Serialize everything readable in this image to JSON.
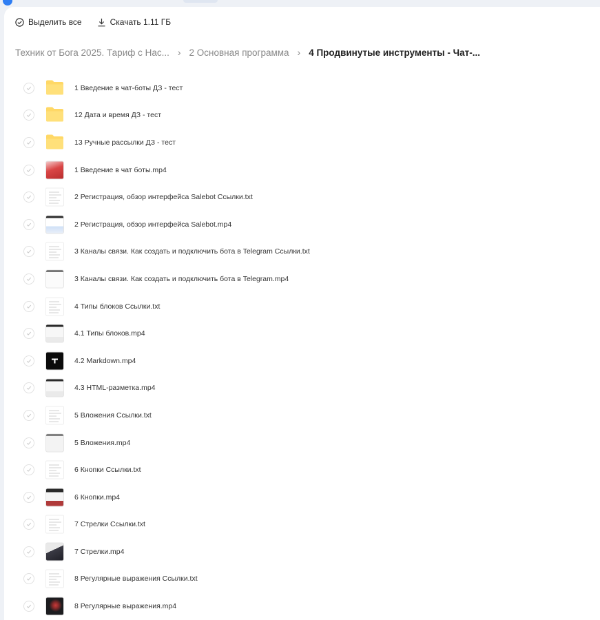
{
  "toolbar": {
    "select_all_label": "Выделить все",
    "download_label": "Скачать 1.11 ГБ"
  },
  "breadcrumb": [
    "Техник от Бога 2025. Тариф с Нас...",
    "2 Основная программа",
    "4 Продвинутые инструменты - Чат-..."
  ],
  "files": [
    {
      "name": "1 Введение в чат-боты ДЗ - тест",
      "kind": "folder"
    },
    {
      "name": "12 Дата и время ДЗ - тест",
      "kind": "folder"
    },
    {
      "name": "13 Ручные рассылки ДЗ - тест",
      "kind": "folder"
    },
    {
      "name": "1 Введение в чат боты.mp4",
      "kind": "video",
      "thumb": "red"
    },
    {
      "name": "2 Регистрация, обзор интерфейса Salebot Ссылки.txt",
      "kind": "doc"
    },
    {
      "name": "2 Регистрация, обзор интерфейса Salebot.mp4",
      "kind": "video",
      "thumb": "ui-blue"
    },
    {
      "name": "3 Каналы связи. Как создать и подключить бота в Telegram Ссылки.txt",
      "kind": "doc"
    },
    {
      "name": "3 Каналы связи. Как создать и подключить бота в Telegram.mp4",
      "kind": "video",
      "thumb": "light"
    },
    {
      "name": "4 Типы блоков Ссылки.txt",
      "kind": "doc"
    },
    {
      "name": "4.1 Типы блоков.mp4",
      "kind": "video",
      "thumb": "light-dark"
    },
    {
      "name": "4.2 Markdown.mp4",
      "kind": "video",
      "thumb": "black"
    },
    {
      "name": "4.3 HTML-разметка.mp4",
      "kind": "video",
      "thumb": "light-dark"
    },
    {
      "name": "5 Вложения Ссылки.txt",
      "kind": "doc"
    },
    {
      "name": "5 Вложения.mp4",
      "kind": "video",
      "thumb": "light-gray"
    },
    {
      "name": "6 Кнопки Ссылки.txt",
      "kind": "doc"
    },
    {
      "name": "6 Кнопки.mp4",
      "kind": "video",
      "thumb": "dark-red"
    },
    {
      "name": "7 Стрелки Ссылки.txt",
      "kind": "doc"
    },
    {
      "name": "7 Стрелки.mp4",
      "kind": "video",
      "thumb": "dark-mount"
    },
    {
      "name": "8 Регулярные выражения Ссылки.txt",
      "kind": "doc"
    },
    {
      "name": "8 Регулярные выражения.mp4",
      "kind": "video",
      "thumb": "dark-face"
    }
  ],
  "colors": {
    "background": "#eef1f6",
    "panel": "#ffffff",
    "folder": "#ffd866",
    "accent": "#2f7ef3"
  },
  "icons": {
    "select_all": "check-circle-icon",
    "download": "download-icon",
    "separator": "chevron-right-icon",
    "row_check": "check-icon"
  }
}
